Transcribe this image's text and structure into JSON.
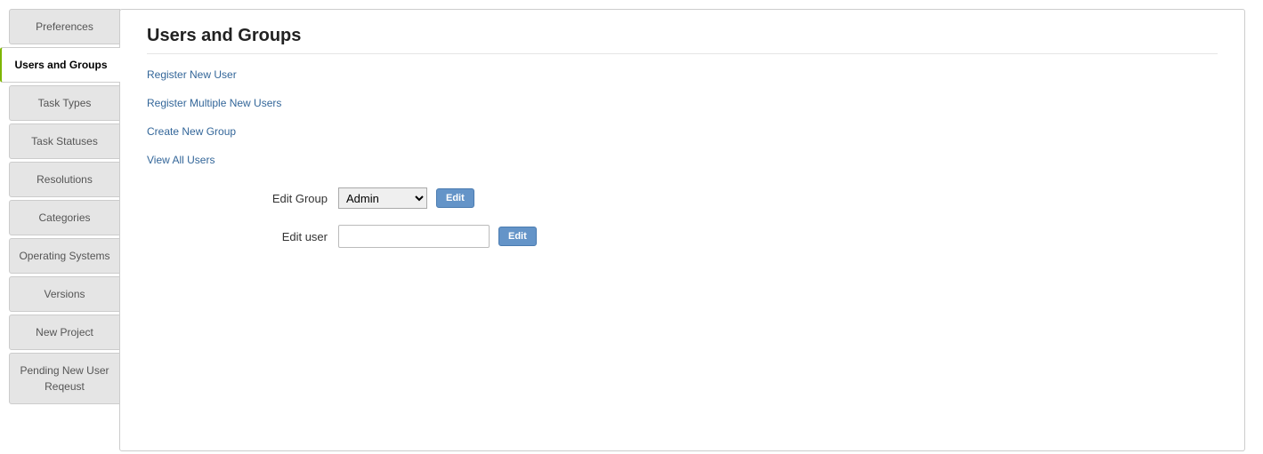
{
  "sidebar": {
    "items": [
      {
        "label": "Preferences",
        "active": false
      },
      {
        "label": "Users and Groups",
        "active": true
      },
      {
        "label": "Task Types",
        "active": false
      },
      {
        "label": "Task Statuses",
        "active": false
      },
      {
        "label": "Resolutions",
        "active": false
      },
      {
        "label": "Categories",
        "active": false
      },
      {
        "label": "Operating Systems",
        "active": false
      },
      {
        "label": "Versions",
        "active": false
      },
      {
        "label": "New Project",
        "active": false
      },
      {
        "label": "Pending New User Reqeust",
        "active": false
      }
    ]
  },
  "main": {
    "title": "Users and Groups",
    "links": {
      "register_new_user": "Register New User",
      "register_multiple": "Register Multiple New Users",
      "create_group": "Create New Group",
      "view_all": "View All Users"
    },
    "form": {
      "edit_group_label": "Edit Group",
      "edit_group_selected": "Admin",
      "edit_group_button": "Edit",
      "edit_user_label": "Edit user",
      "edit_user_value": "",
      "edit_user_button": "Edit"
    }
  }
}
